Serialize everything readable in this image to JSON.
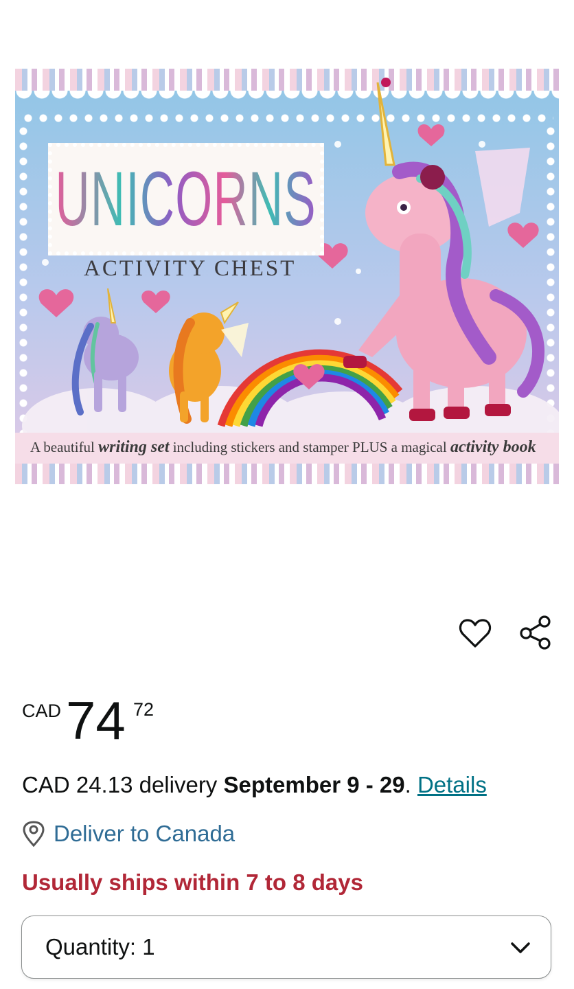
{
  "product_image": {
    "title": "UNICORNS",
    "subtitle": "ACTIVITY CHEST",
    "tagline_parts": [
      "A beautiful",
      "writing set",
      "including stickers and stamper PLUS a magical",
      "activity book"
    ]
  },
  "actions": {
    "wishlist_icon": "heart-outline-icon",
    "share_icon": "share-icon"
  },
  "price": {
    "currency": "CAD",
    "whole": "74",
    "fraction": "72"
  },
  "delivery": {
    "fee_text": "CAD 24.13 delivery",
    "date_range": "September 9 - 29",
    "period": ".",
    "details_link": "Details",
    "location_label": "Deliver to Canada",
    "availability": "Usually ships within 7 to 8 days"
  },
  "quantity": {
    "label": "Quantity:",
    "value": "1"
  },
  "colors": {
    "link": "#007185",
    "location": "#2f6c95",
    "availability": "#b12737"
  }
}
